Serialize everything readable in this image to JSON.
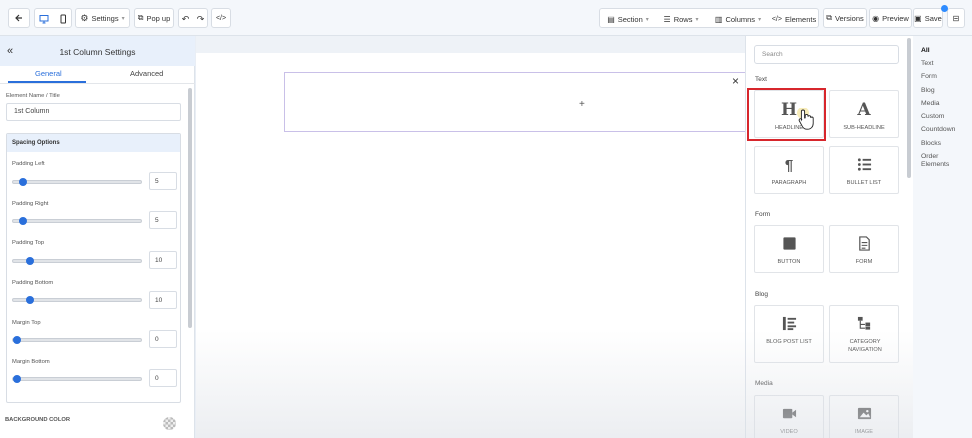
{
  "toolbar": {
    "settings_label": "Settings",
    "popup_label": "Pop up",
    "section_label": "Section",
    "rows_label": "Rows",
    "columns_label": "Columns",
    "elements_label": "Elements",
    "versions_label": "Versions",
    "preview_label": "Preview",
    "save_label": "Save"
  },
  "left_panel": {
    "title": "1st Column Settings",
    "tabs": [
      "General",
      "Advanced"
    ],
    "element_name_label": "Element Name / Title",
    "element_name_value": "1st Column",
    "spacing_title": "Spacing Options",
    "spacing": [
      {
        "label": "Padding Left",
        "value": "5"
      },
      {
        "label": "Padding Right",
        "value": "5"
      },
      {
        "label": "Padding Top",
        "value": "10"
      },
      {
        "label": "Padding Bottom",
        "value": "10"
      },
      {
        "label": "Margin Top",
        "value": "0"
      },
      {
        "label": "Margin Bottom",
        "value": "0"
      }
    ],
    "background_color_label": "BACKGROUND COLOR"
  },
  "canvas": {
    "add_symbol": "+",
    "close_symbol": "×"
  },
  "elements_panel": {
    "search_placeholder": "Search",
    "groups": [
      {
        "name": "Text",
        "items": [
          "HEADLINE",
          "SUB-HEADLINE",
          "PARAGRAPH",
          "BULLET LIST"
        ]
      },
      {
        "name": "Form",
        "items": [
          "BUTTON",
          "FORM"
        ]
      },
      {
        "name": "Blog",
        "items": [
          "BLOG POST LIST",
          "CATEGORY NAVIGATION"
        ]
      },
      {
        "name": "Media",
        "items": [
          "VIDEO",
          "IMAGE"
        ]
      }
    ]
  },
  "categories": [
    "All",
    "Text",
    "Form",
    "Blog",
    "Media",
    "Custom",
    "Countdown",
    "Blocks",
    "Order Elements"
  ],
  "colors": {
    "accent": "#2a6fdb",
    "highlight": "#d7262c"
  }
}
